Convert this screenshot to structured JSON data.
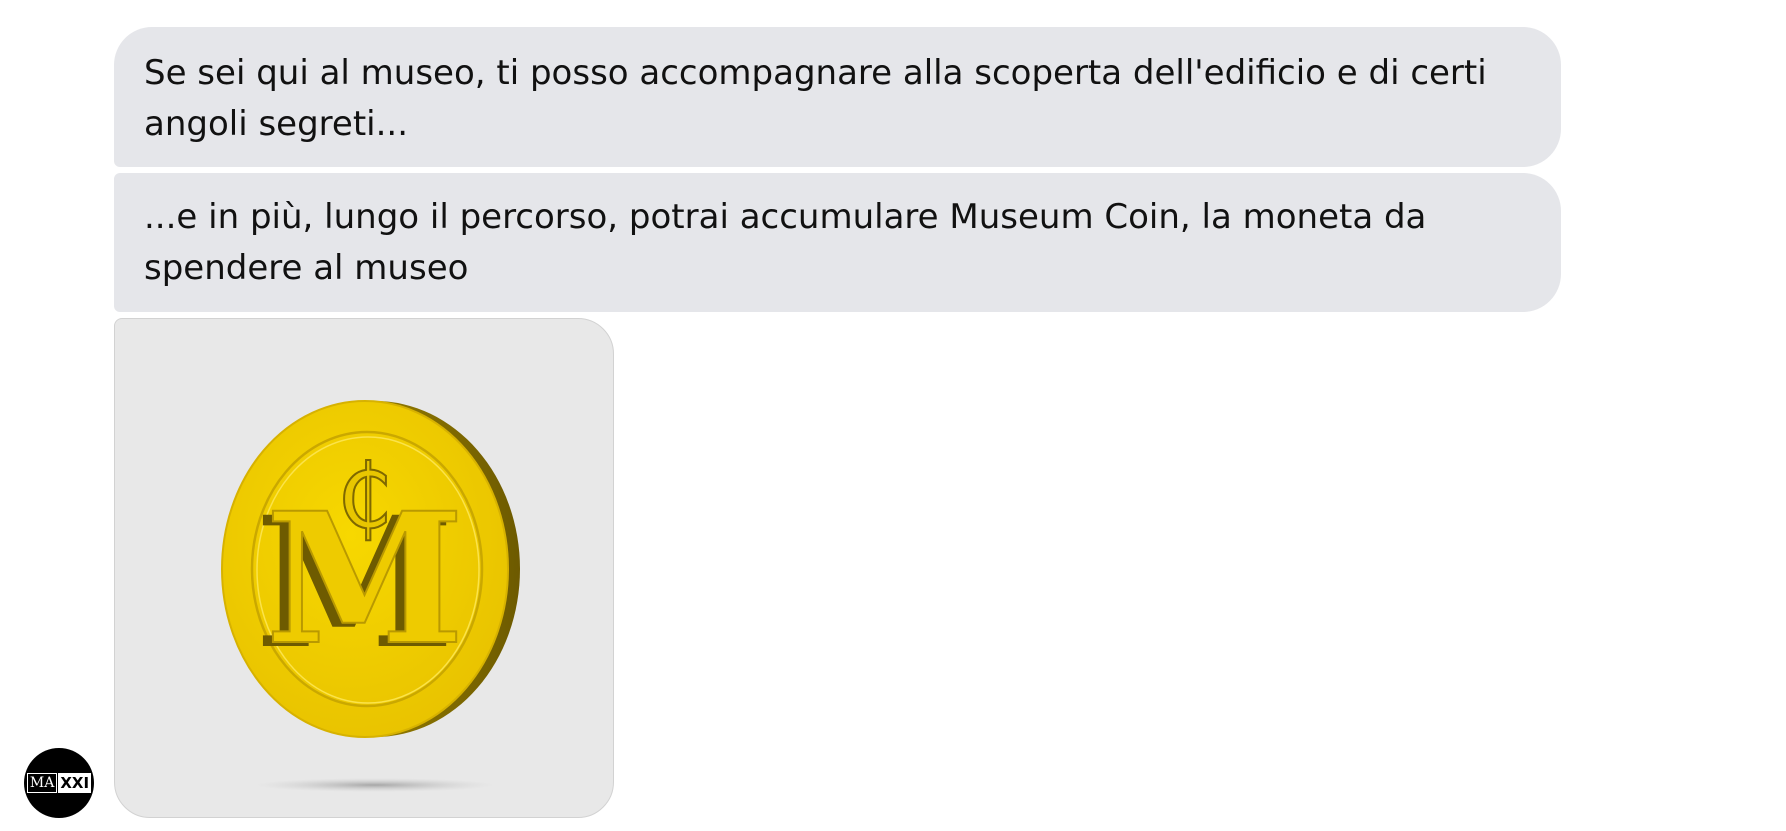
{
  "messages": [
    {
      "text": "Se sei qui al museo, ti posso accompagnare alla scoperta dell'edificio e di certi angoli segreti..."
    },
    {
      "text": "...e in più, lungo il percorso, potrai accumulare Museum Coin, la moneta da spendere al museo"
    }
  ],
  "coin_card": {
    "letter": "M",
    "symbol": "₵",
    "icon": "museum-coin-image",
    "color_face": "#f0cb00",
    "color_edge": "#8c7400"
  },
  "avatar": {
    "logo_left": "MA",
    "logo_right": "XXI"
  }
}
